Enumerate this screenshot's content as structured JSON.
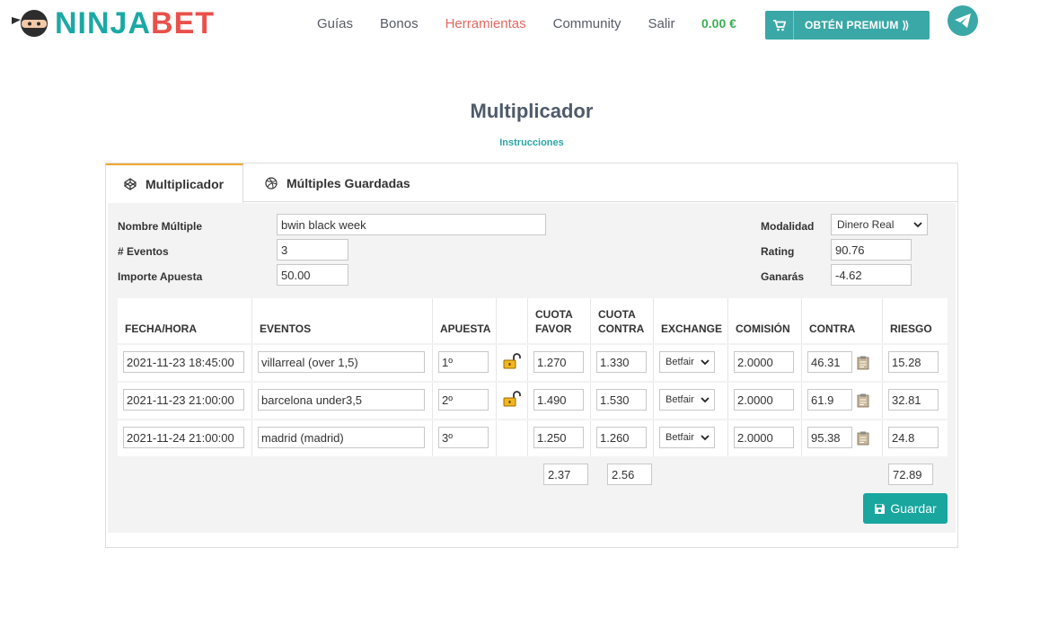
{
  "header": {
    "logo_part1": "NINJA",
    "logo_part2": "BET",
    "nav": [
      "Guías",
      "Bonos",
      "Herramientas",
      "Community",
      "Salir"
    ],
    "active_nav": "Herramientas",
    "balance": "0.00 €",
    "premium_label": "OBTÉN PREMIUM ⟫"
  },
  "page": {
    "title": "Multiplicador",
    "instructions": "Instrucciones"
  },
  "tabs": [
    "Multiplicador",
    "Múltiples Guardadas"
  ],
  "form": {
    "nombre_label": "Nombre Múltiple",
    "nombre_value": "bwin black week",
    "eventos_label": "# Eventos",
    "eventos_value": "3",
    "importe_label": "Importe Apuesta",
    "importe_value": "50.00",
    "modalidad_label": "Modalidad",
    "modalidad_value": "Dinero Real",
    "rating_label": "Rating",
    "rating_value": "90.76",
    "ganaras_label": "Ganarás",
    "ganaras_value": "-4.62"
  },
  "table": {
    "headers": [
      "FECHA/HORA",
      "EVENTOS",
      "APUESTA",
      "",
      "CUOTA\nFAVOR",
      "CUOTA\nCONTRA",
      "EXCHANGE",
      "COMISIÓN",
      "CONTRA",
      "RIESGO"
    ],
    "rows": [
      {
        "fecha": "2021-11-23 18:45:00",
        "evento": "villarreal (over 1,5)",
        "apuesta": "1º",
        "lock": true,
        "favor": "1.270",
        "contra_cuota": "1.330",
        "exchange": "Betfair",
        "comision": "2.0000",
        "contra": "46.31",
        "riesgo": "15.28"
      },
      {
        "fecha": "2021-11-23 21:00:00",
        "evento": "barcelona under3,5",
        "apuesta": "2º",
        "lock": true,
        "favor": "1.490",
        "contra_cuota": "1.530",
        "exchange": "Betfair",
        "comision": "2.0000",
        "contra": "61.9",
        "riesgo": "32.81"
      },
      {
        "fecha": "2021-11-24 21:00:00",
        "evento": "madrid (madrid)",
        "apuesta": "3º",
        "lock": false,
        "favor": "1.250",
        "contra_cuota": "1.260",
        "exchange": "Betfair",
        "comision": "2.0000",
        "contra": "95.38",
        "riesgo": "24.8"
      }
    ],
    "totals": {
      "favor": "2.37",
      "contra_cuota": "2.56",
      "riesgo": "72.89"
    }
  },
  "save_label": "Guardar",
  "colors": {
    "teal": "#1aa9a5",
    "red": "#e9514b",
    "green": "#3cae53",
    "orange": "#f0a830"
  }
}
